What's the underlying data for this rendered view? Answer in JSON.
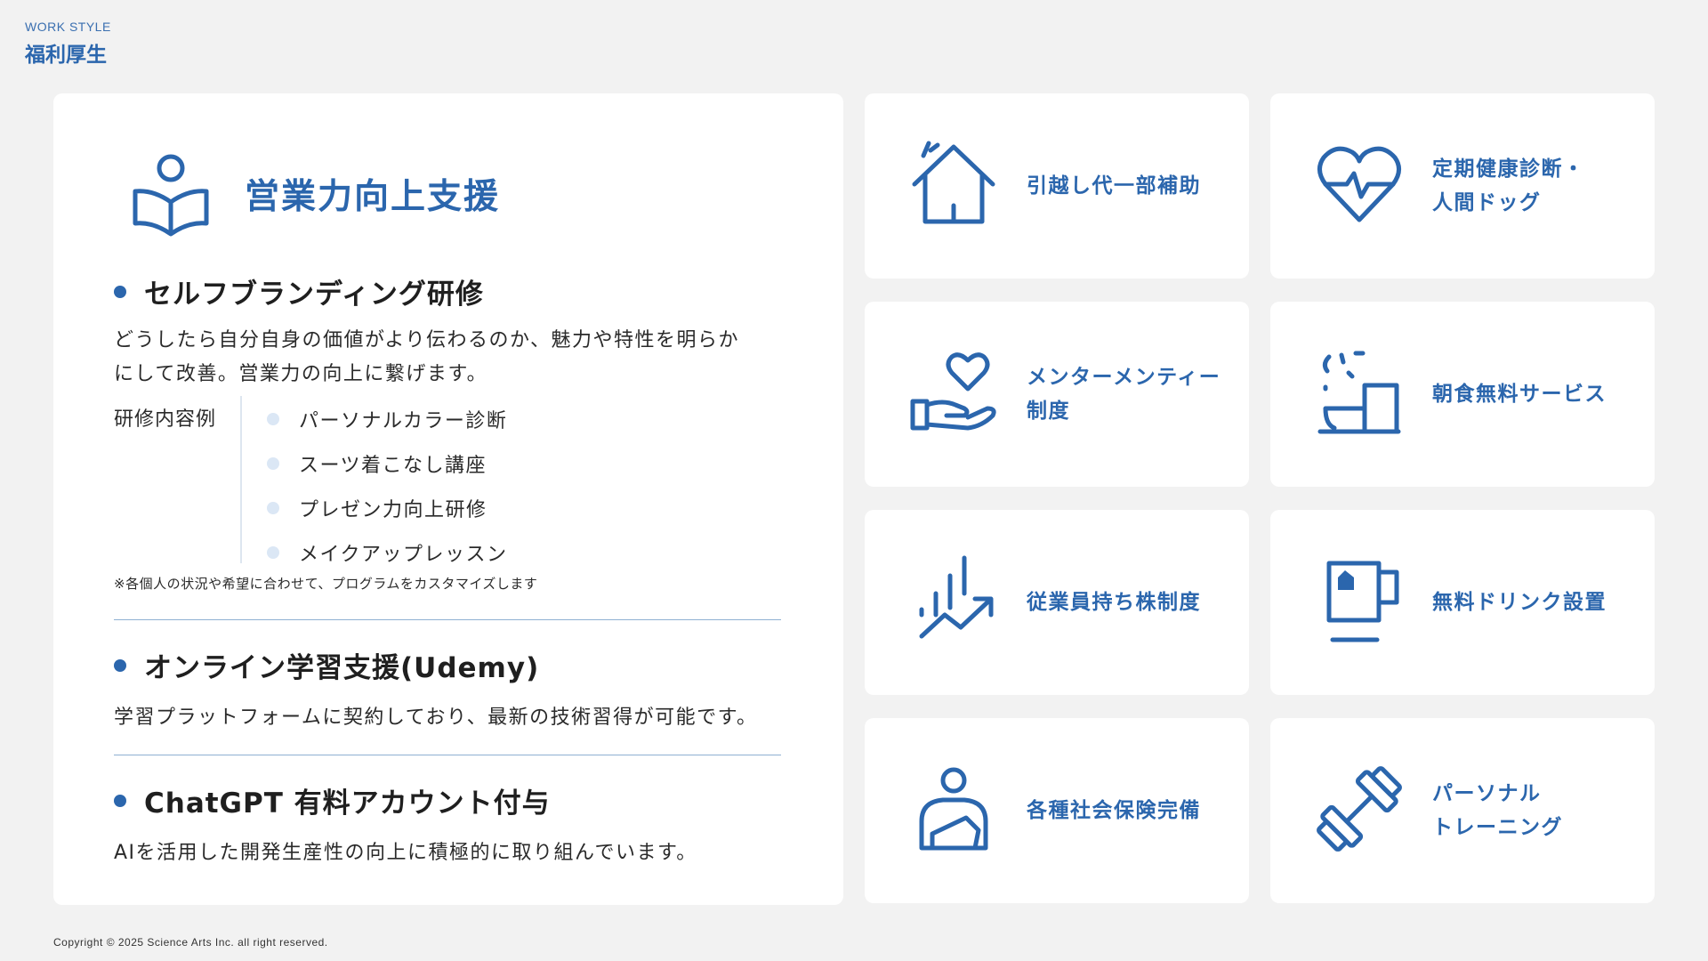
{
  "header": {
    "subtitle": "WORK STYLE",
    "title": "福利厚生"
  },
  "main_card": {
    "icon": "reading-person-icon",
    "title": "営業力向上支援",
    "section1": {
      "heading": "セルフブランディング研修",
      "line1": "どうしたら自分自身の価値がより伝わるのか、魅力や特性を明らか",
      "line2": "にして改善。営業力の向上に繋げます。",
      "examples_label": "研修内容例",
      "examples": [
        "パーソナルカラー診断",
        "スーツ着こなし講座",
        "プレゼン力向上研修",
        "メイクアップレッスン"
      ],
      "note": "※各個人の状況や希望に合わせて、プログラムをカスタマイズします"
    },
    "section2": {
      "heading": "オンライン学習支援(Udemy)",
      "text": "学習プラットフォームに契約しており、最新の技術習得が可能です。"
    },
    "section3": {
      "heading": "ChatGPT 有料アカウント付与",
      "text": "AIを活用した開発生産性の向上に積極的に取り組んでいます。"
    }
  },
  "tiles": [
    {
      "icon": "house-icon",
      "line1": "引越し代一部補助",
      "line2": ""
    },
    {
      "icon": "heart-pulse-icon",
      "line1": "定期健康診断・",
      "line2": "人間ドッグ"
    },
    {
      "icon": "heart-hand-icon",
      "line1": "メンターメンティー",
      "line2": "制度"
    },
    {
      "icon": "breakfast-icon",
      "line1": "朝食無料サービス",
      "line2": ""
    },
    {
      "icon": "growth-chart-icon",
      "line1": "従業員持ち株制度",
      "line2": ""
    },
    {
      "icon": "mug-icon",
      "line1": "無料ドリンク設置",
      "line2": ""
    },
    {
      "icon": "injured-person-icon",
      "line1": "各種社会保険完備",
      "line2": ""
    },
    {
      "icon": "dumbbell-icon",
      "line1": "パーソナル",
      "line2": "トレーニング"
    }
  ],
  "footer": {
    "copyright": "Copyright © 2025 Science Arts Inc. all right reserved."
  },
  "colors": {
    "accent": "#2b66ad",
    "background": "#f2f2f2",
    "card": "#ffffff",
    "light_dot": "#dbe7f5"
  }
}
